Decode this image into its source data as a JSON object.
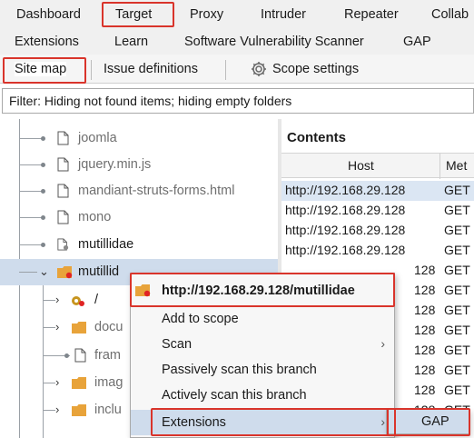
{
  "menu": {
    "row1": [
      "Dashboard",
      "Target",
      "Proxy",
      "Intruder",
      "Repeater",
      "Collab"
    ],
    "row2": [
      "Extensions",
      "Learn",
      "Software Vulnerability Scanner",
      "GAP"
    ]
  },
  "subtabs": {
    "site_map": "Site map",
    "issue_definitions": "Issue definitions",
    "scope_settings": "Scope settings"
  },
  "filter": "Filter: Hiding not found items;  hiding empty folders",
  "tree": {
    "items": [
      {
        "label": "joomla",
        "type": "file",
        "style": "gray"
      },
      {
        "label": "jquery.min.js",
        "type": "file",
        "style": "gray"
      },
      {
        "label": "mandiant-struts-forms.html",
        "type": "file",
        "style": "gray"
      },
      {
        "label": "mono",
        "type": "file",
        "style": "gray"
      },
      {
        "label": "mutillidae",
        "type": "file-gear",
        "style": "dark"
      },
      {
        "label": "mutillid",
        "type": "folder-red",
        "style": "dark",
        "selected": true
      },
      {
        "label": "/",
        "type": "gear",
        "style": "dark"
      },
      {
        "label": "docu",
        "type": "folder",
        "style": "gray"
      },
      {
        "label": "fram",
        "type": "file",
        "style": "gray"
      },
      {
        "label": "imag",
        "type": "folder",
        "style": "gray"
      },
      {
        "label": "inclu",
        "type": "folder",
        "style": "gray"
      }
    ]
  },
  "contents": {
    "title": "Contents",
    "columns": [
      "Host",
      "Met"
    ],
    "rows": [
      {
        "host": "http://192.168.29.128",
        "method": "GET"
      },
      {
        "host": "http://192.168.29.128",
        "method": "GET"
      },
      {
        "host": "http://192.168.29.128",
        "method": "GET"
      },
      {
        "host": "http://192.168.29.128",
        "method": "GET"
      },
      {
        "host": "128",
        "method": "GET"
      },
      {
        "host": "128",
        "method": "GET"
      },
      {
        "host": "128",
        "method": "GET"
      },
      {
        "host": "128",
        "method": "GET"
      },
      {
        "host": "128",
        "method": "GET"
      },
      {
        "host": "128",
        "method": "GET"
      },
      {
        "host": "128",
        "method": "GET"
      },
      {
        "host": "128",
        "method": "GET"
      }
    ]
  },
  "context_menu": {
    "header": "http://192.168.29.128/mutillidae",
    "items": [
      "Add to scope",
      "Scan",
      "Passively scan this branch",
      "Actively scan this branch",
      "Extensions"
    ],
    "submenu_item": "GAP"
  },
  "colors": {
    "highlight_red": "#d9342b",
    "selection_blue": "#cfdcec",
    "folder_orange": "#e8a33a",
    "issue_red": "#e02424"
  }
}
